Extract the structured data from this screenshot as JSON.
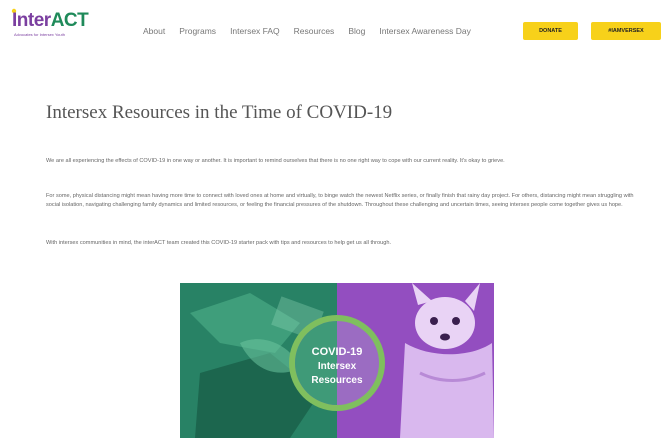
{
  "header": {
    "logo": {
      "prefix": "Inter",
      "suffix": "ACT",
      "tagline": "Advocates for Intersex Youth"
    },
    "nav": [
      {
        "label": "About"
      },
      {
        "label": "Programs"
      },
      {
        "label": "Intersex FAQ"
      },
      {
        "label": "Resources"
      },
      {
        "label": "Blog"
      },
      {
        "label": "Intersex Awareness Day"
      }
    ],
    "buttons": {
      "donate": "Donate",
      "awareness": "#IAMVERSEX"
    }
  },
  "article": {
    "title": "Intersex Resources in the Time of COVID-19",
    "paragraphs": [
      "We are all experiencing the effects of COVID-19 in one way or another. It is important to remind ourselves that there is no one right way to cope with our current reality. It's okay to grieve.",
      "For some, physical distancing might mean having more time to connect with loved ones at home and virtually, to binge watch the newest Netflix series, or finally finish that rainy day project. For others, distancing might mean struggling with social isolation, navigating challenging family dynamics and limited resources, or feeling the financial pressures of the shutdown. Throughout these challenging and uncertain times, seeing intersex people come together gives us hope.",
      "With intersex communities in mind, the interACT team created this COVID-19 starter pack with tips and resources to help get us all through."
    ],
    "hero": {
      "badge_lines": [
        "COVID-19",
        "Intersex",
        "Resources"
      ]
    }
  },
  "colors": {
    "accent_yellow": "#f7d11a",
    "brand_purple": "#7b3fa0",
    "brand_green": "#1f8a5a",
    "hero_green": "#2f8f6f",
    "hero_purple": "#9b55c8"
  }
}
